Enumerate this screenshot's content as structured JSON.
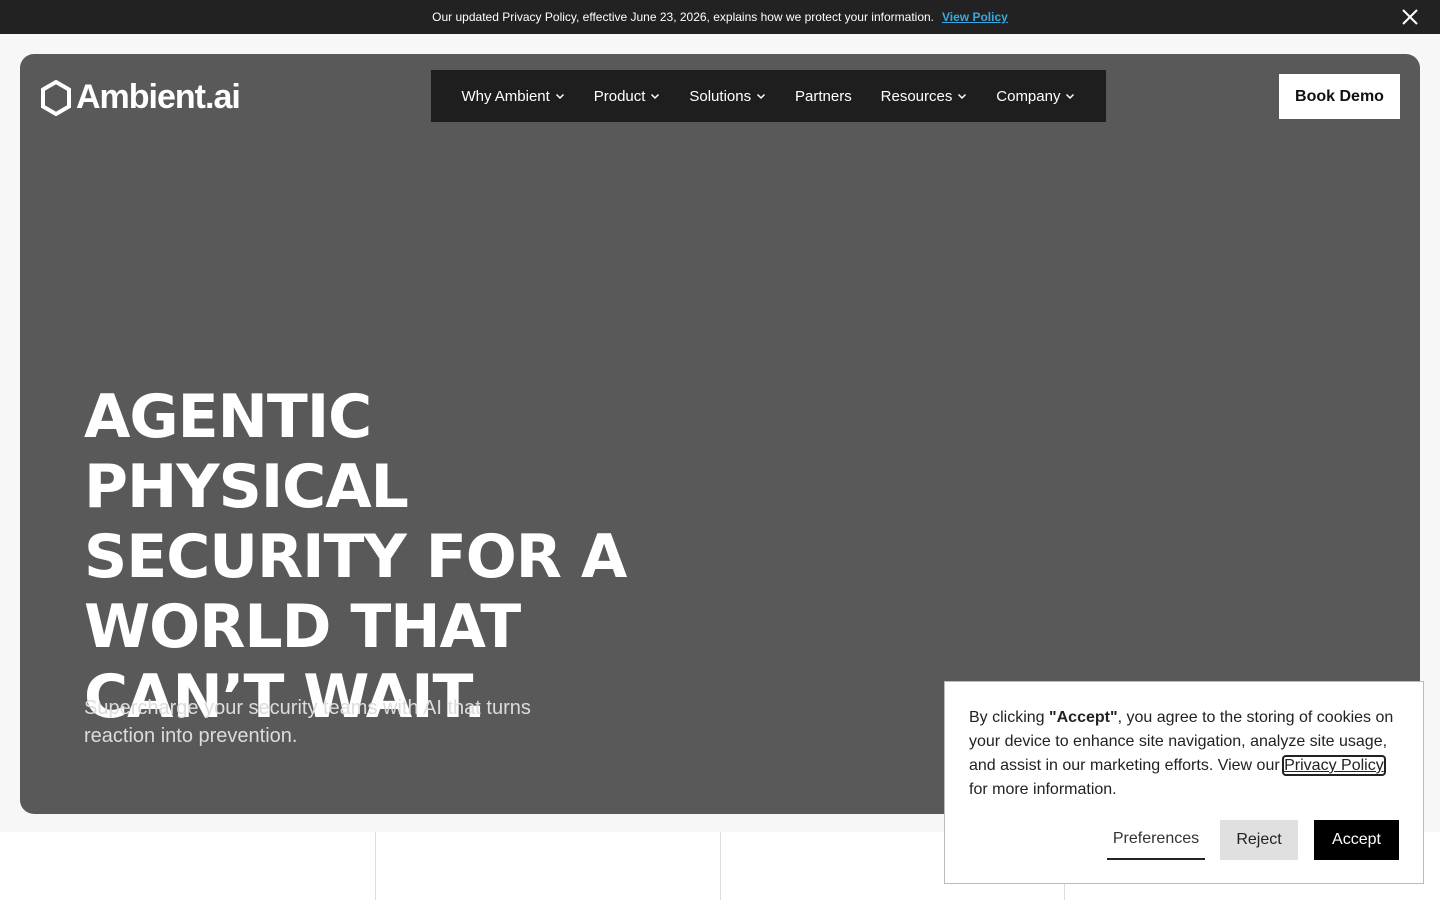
{
  "banner": {
    "text": "Our updated Privacy Policy, effective June 23, 2026, explains how we protect your information.",
    "link_label": "View Policy"
  },
  "brand": {
    "name": "Ambient.ai"
  },
  "nav": {
    "items": [
      {
        "label": "Why Ambient",
        "has_dropdown": true
      },
      {
        "label": "Product",
        "has_dropdown": true
      },
      {
        "label": "Solutions",
        "has_dropdown": true
      },
      {
        "label": "Partners",
        "has_dropdown": false
      },
      {
        "label": "Resources",
        "has_dropdown": true
      },
      {
        "label": "Company",
        "has_dropdown": true
      }
    ],
    "cta_label": "Book Demo"
  },
  "hero": {
    "headline": "Agentic physical security for a world that can’t wait.",
    "subheadline": "Supercharge your security teams with AI that turns reaction into prevention."
  },
  "cookie": {
    "text_pre": "By clicking ",
    "text_bold": "\"Accept\"",
    "text_mid": ", you agree to the storing of cookies on your device to enhance site navigation, analyze site usage, and assist in our marketing efforts. View our ",
    "link_label": "Privacy Policy",
    "text_post": " for more information.",
    "preferences_label": "Preferences",
    "reject_label": "Reject",
    "accept_label": "Accept"
  },
  "colors": {
    "hero_bg": "#595959",
    "nav_bg": "#1e1e1e",
    "banner_bg": "#222222",
    "link_blue": "#3aa8e0"
  }
}
